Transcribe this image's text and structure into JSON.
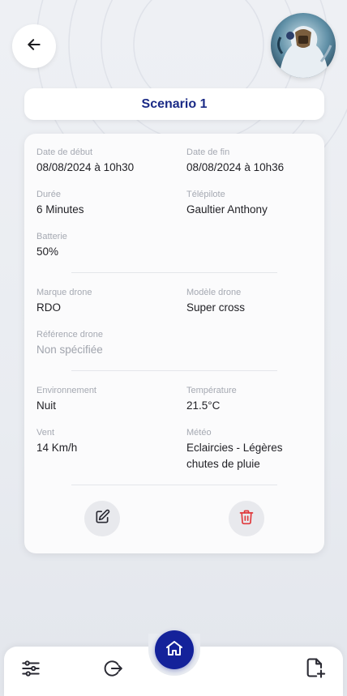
{
  "header": {
    "title": "Scenario 1",
    "avatar_alt": "avatar"
  },
  "details": {
    "date_debut": {
      "label": "Date de début",
      "value": "08/08/2024 à 10h30"
    },
    "date_fin": {
      "label": "Date de fin",
      "value": "08/08/2024 à 10h36"
    },
    "duree": {
      "label": "Durée",
      "value": "6 Minutes"
    },
    "telepilote": {
      "label": "Télépilote",
      "value": "Gaultier Anthony"
    },
    "batterie": {
      "label": "Batterie",
      "value": "50%"
    },
    "marque": {
      "label": "Marque drone",
      "value": "RDO"
    },
    "modele": {
      "label": "Modèle drone",
      "value": "Super cross"
    },
    "reference": {
      "label": "Référence drone",
      "value": "Non spécifiée"
    },
    "environnement": {
      "label": "Environnement",
      "value": "Nuit"
    },
    "temperature": {
      "label": "Température",
      "value": "21.5°C"
    },
    "vent": {
      "label": "Vent",
      "value": "14 Km/h"
    },
    "meteo": {
      "label": "Météo",
      "value": "Eclaircies - Légères chutes de pluie"
    }
  },
  "actions": {
    "edit_icon": "edit-icon",
    "delete_icon": "trash-icon"
  },
  "nav": {
    "items": [
      "filters-icon",
      "logout-icon",
      "home-icon",
      "new-document-icon"
    ]
  },
  "colors": {
    "accent": "#14229a",
    "title": "#1a2a86",
    "delete": "#e0383b",
    "background": "#eef0f4"
  }
}
